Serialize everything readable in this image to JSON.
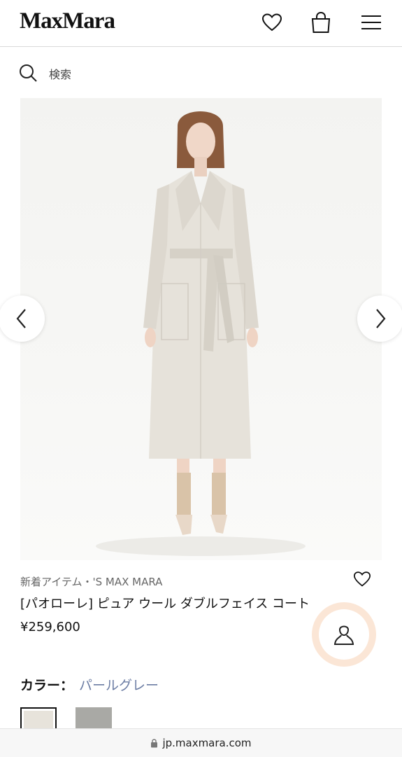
{
  "header": {
    "logo": "MaxMara",
    "icons": [
      "heart-icon",
      "shopping-bag-icon",
      "menu-icon"
    ]
  },
  "search": {
    "label": "検索",
    "icon": "search-icon"
  },
  "gallery": {
    "prev_icon": "chevron-left-icon",
    "next_icon": "chevron-right-icon"
  },
  "product": {
    "category": "新着アイテム・'S MAX MARA",
    "name": "[パオローレ] ピュア ウール ダブルフェイス コート",
    "price": "¥259,600",
    "wishlist_icon": "heart-icon"
  },
  "color": {
    "label": "カラー：",
    "value": "パールグレー",
    "swatches": [
      "#e7e3db",
      "#a9a9a5"
    ]
  },
  "contact": {
    "icon": "user-icon",
    "ring_color": "#fbe6d6"
  },
  "browser": {
    "url": "jp.maxmara.com"
  }
}
